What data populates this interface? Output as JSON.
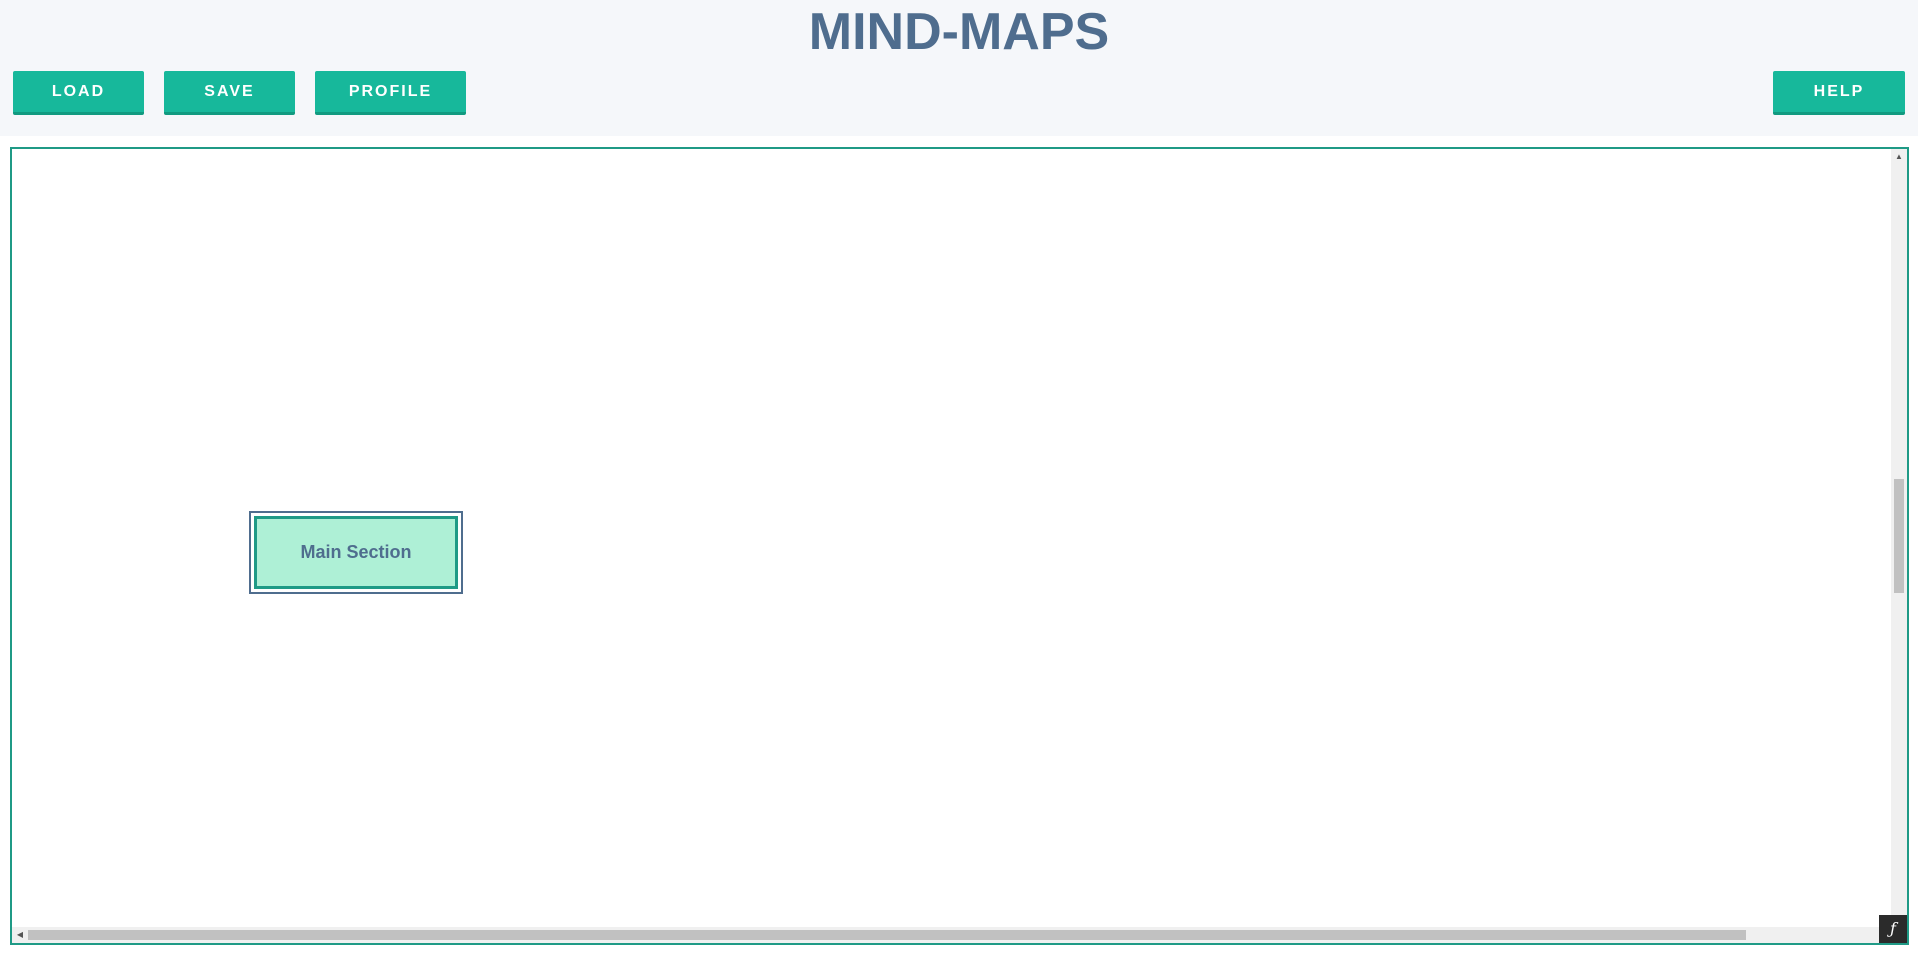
{
  "header": {
    "title": "MIND-MAPS",
    "buttons": {
      "load": "LOAD",
      "save": "SAVE",
      "profile": "PROFILE",
      "help": "HELP"
    }
  },
  "canvas": {
    "nodes": [
      {
        "label": "Main Section"
      }
    ]
  },
  "scrollbars": {
    "up_icon": "▲",
    "down_icon": "▼",
    "left_icon": "◀",
    "right_icon": "▶"
  },
  "corner_badge": {
    "glyph": "ƒ"
  },
  "colors": {
    "accent": "#17b89b",
    "title": "#4f6d8e",
    "node_fill": "#aef0d6",
    "node_border": "#1f9a86",
    "header_bg": "#f5f7fa"
  }
}
